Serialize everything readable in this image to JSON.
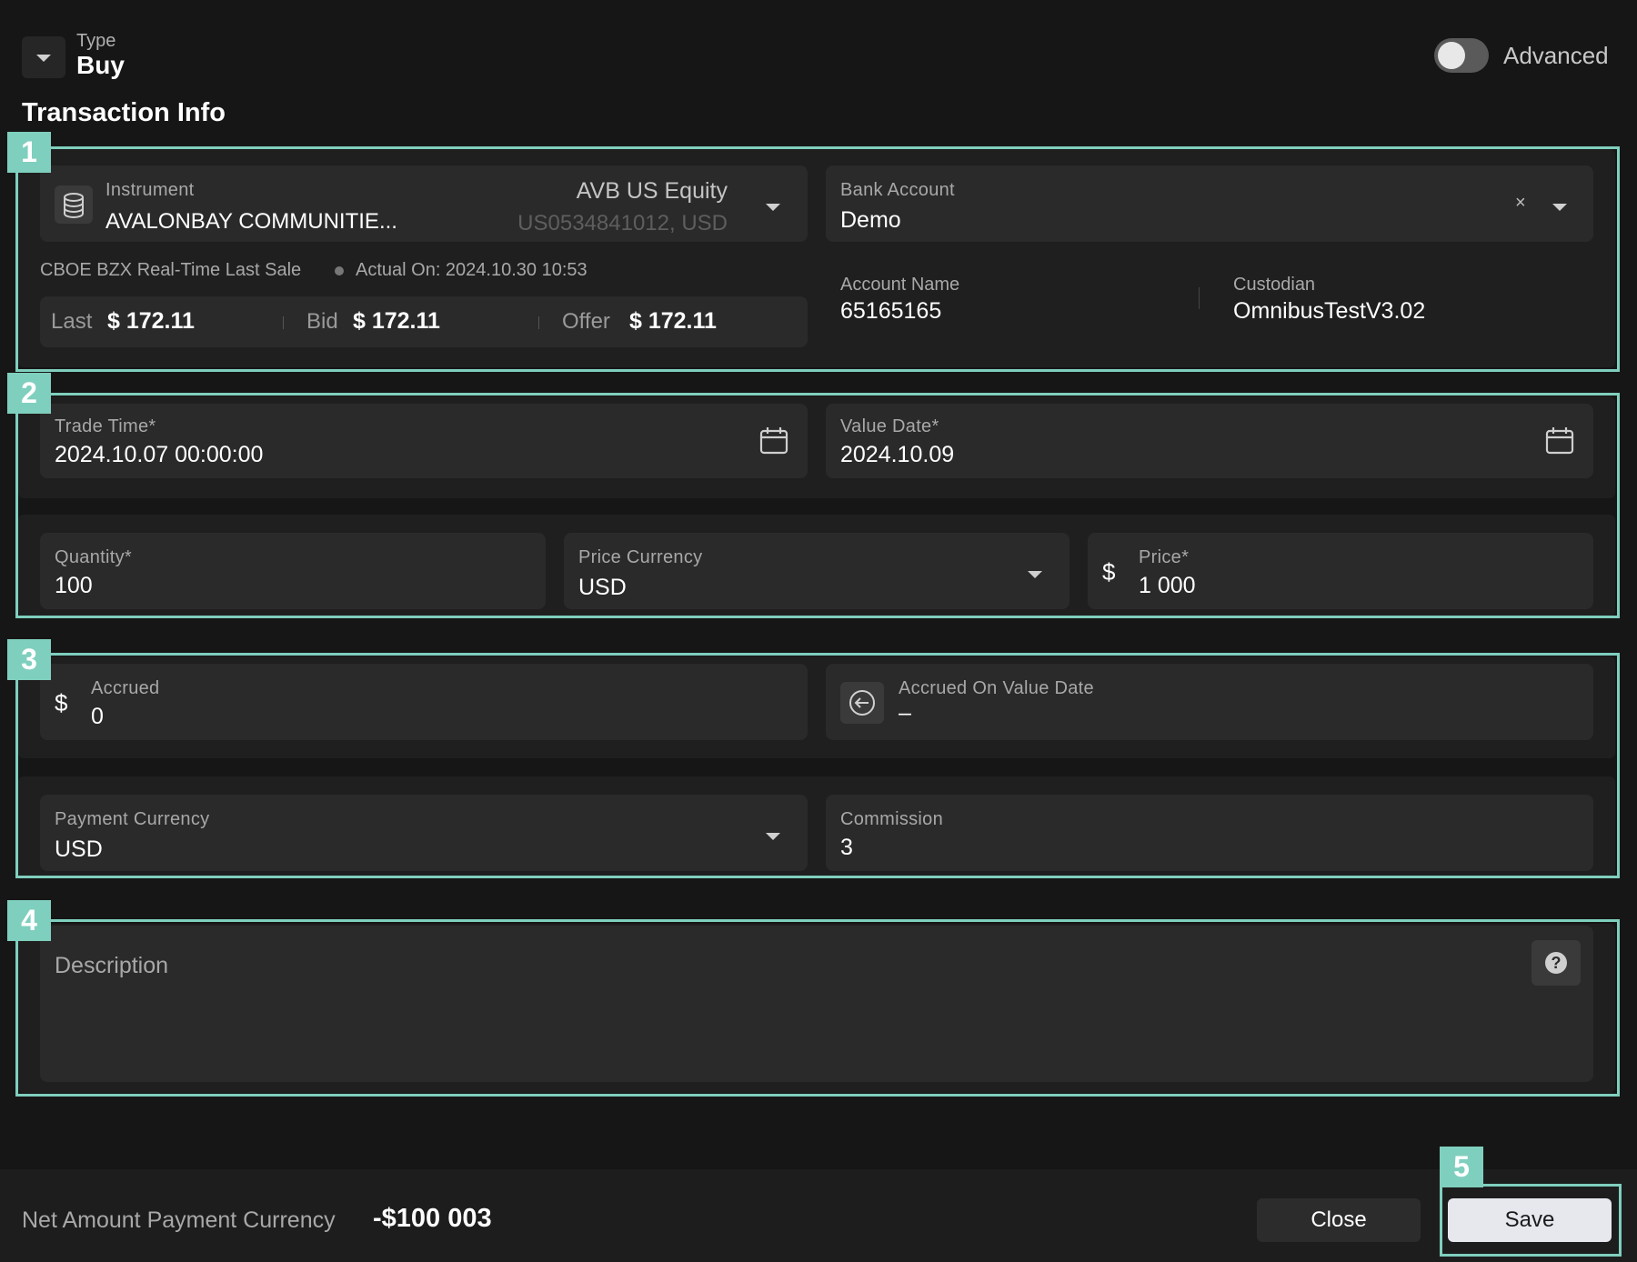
{
  "header": {
    "type_label": "Type",
    "type_value": "Buy",
    "advanced_label": "Advanced",
    "section_title": "Transaction Info"
  },
  "badges": [
    "1",
    "2",
    "3",
    "4",
    "5"
  ],
  "instrument": {
    "label": "Instrument",
    "name": "AVALONBAY COMMUNITIE...",
    "ticker": "AVB US Equity",
    "isin": "US0534841012, USD",
    "icon": "coins-stack-icon"
  },
  "quote": {
    "source": "CBOE BZX Real-Time Last Sale",
    "actual_on": "Actual On: 2024.10.30 10:53",
    "last_label": "Last",
    "last_value": "$ 172.11",
    "bid_label": "Bid",
    "bid_value": "$ 172.11",
    "offer_label": "Offer",
    "offer_value": "$ 172.11"
  },
  "bank_account": {
    "label": "Bank Account",
    "value": "Demo",
    "clear": "×",
    "account_name_label": "Account Name",
    "account_name_value": "65165165",
    "custodian_label": "Custodian",
    "custodian_value": "OmnibusTestV3.02"
  },
  "dates": {
    "trade_time_label": "Trade Time*",
    "trade_time_value": "2024.10.07 00:00:00",
    "value_date_label": "Value Date*",
    "value_date_value": "2024.10.09"
  },
  "order": {
    "quantity_label": "Quantity*",
    "quantity_value": "100",
    "price_currency_label": "Price Currency",
    "price_currency_value": "USD",
    "price_label": "Price*",
    "price_symbol": "$",
    "price_value": "1 000"
  },
  "accrued": {
    "symbol": "$",
    "label": "Accrued",
    "value": "0",
    "on_value_date_label": "Accrued On Value Date",
    "on_value_date_value": "–"
  },
  "payment": {
    "currency_label": "Payment Currency",
    "currency_value": "USD",
    "commission_label": "Commission",
    "commission_value": "3"
  },
  "description": {
    "placeholder": "Description",
    "help": "?"
  },
  "footer": {
    "net_label": "Net Amount Payment Currency",
    "net_value": "-$100 003",
    "close_label": "Close",
    "save_label": "Save"
  },
  "colors": {
    "background": "#161616",
    "field": "#2a2a2a",
    "highlight": "#7fcfbe",
    "save_button": "#e6e8ee"
  }
}
